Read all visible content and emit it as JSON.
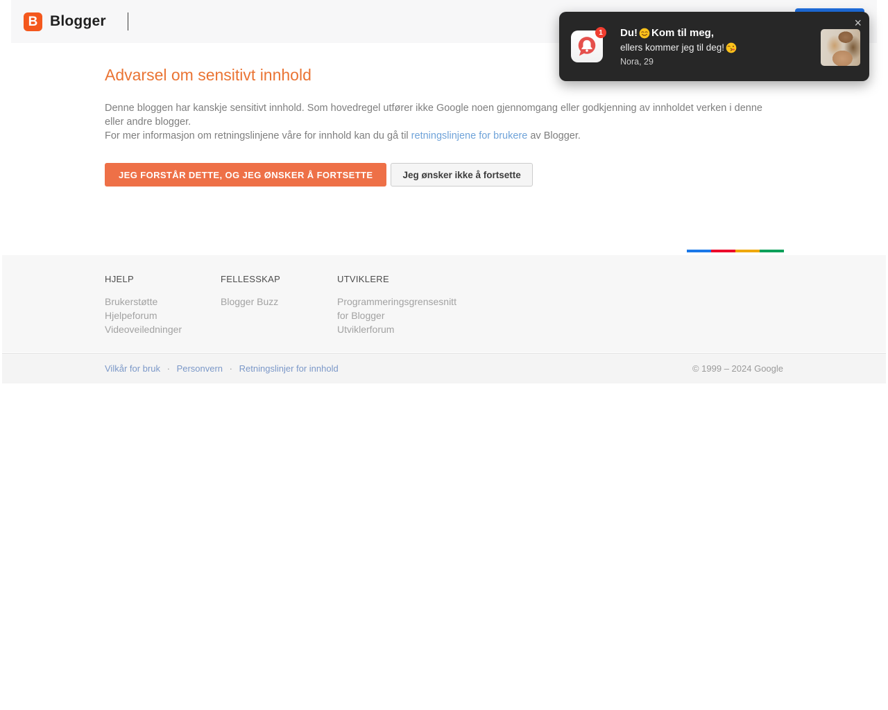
{
  "header": {
    "logo_letter": "B",
    "brand": "Blogger"
  },
  "notification": {
    "close_icon": "×",
    "badge_count": "1",
    "title_prefix": "Du!",
    "title_suffix": "Kom til meg,",
    "line2_text": "ellers kommer jeg til deg!",
    "sender": "Nora, 29"
  },
  "main": {
    "heading": "Advarsel om sensitivt innhold",
    "paragraph_line1": "Denne bloggen har kanskje sensitivt innhold. Som hovedregel utfører ikke Google noen gjennomgang eller godkjenning av innholdet verken i denne eller andre blogger.",
    "paragraph_line2_before_link": "For mer informasjon om retningslinjene våre for innhold kan du gå til ",
    "paragraph_link": "retningslinjene for brukere",
    "paragraph_line2_after_link": " av Blogger.",
    "continue_button": "JEG FORSTÅR DETTE, OG JEG ØNSKER Å FORTSETTE",
    "decline_button": "Jeg ønsker ikke å fortsette"
  },
  "footer": {
    "google_bar_colors": [
      "#1a78e8",
      "#ec0c2b",
      "#efa80d",
      "#0da05a"
    ],
    "columns": [
      {
        "heading": "HJELP",
        "links": [
          "Brukerstøtte",
          "Hjelpeforum",
          "Videoveiledninger"
        ]
      },
      {
        "heading": "FELLESSKAP",
        "links": [
          "Blogger Buzz"
        ]
      },
      {
        "heading": "UTVIKLERE",
        "links": [
          "Programmeringsgrensesnitt for Blogger",
          "Utviklerforum"
        ]
      }
    ],
    "legal_links": [
      "Vilkår for bruk",
      "Personvern",
      "Retningslinjer for innhold"
    ],
    "legal_separator": "·",
    "copyright": "© 1999 – 2024 Google"
  }
}
